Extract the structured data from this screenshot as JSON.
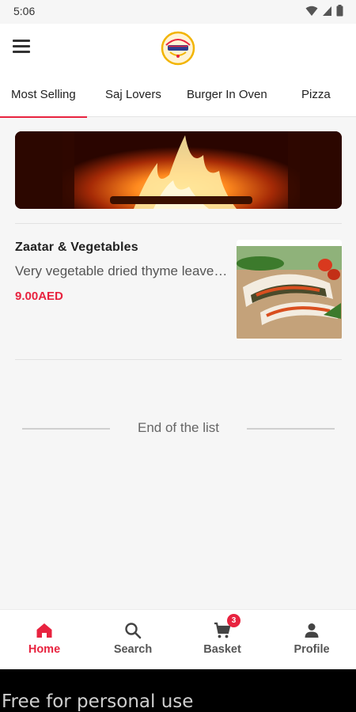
{
  "status_bar": {
    "time": "5:06",
    "icons": [
      "wifi-icon",
      "signal-icon",
      "battery-icon"
    ]
  },
  "app_bar": {
    "menu_icon": "hamburger-menu-icon",
    "logo": "restaurant-logo"
  },
  "tabs": [
    {
      "label": "Most Selling",
      "active": true
    },
    {
      "label": "Saj Lovers",
      "active": false
    },
    {
      "label": "Burger In Oven",
      "active": false
    },
    {
      "label": "Pizza",
      "active": false
    }
  ],
  "banner": {
    "image": "fire-oven-banner"
  },
  "products": [
    {
      "name": "Zaatar & Vegetables",
      "description": "Very vegetable dried thyme leaves with olive oil",
      "price": "9.00AED",
      "image": "wrap-sandwich-photo"
    }
  ],
  "end_of_list": "End of the list",
  "bottom_nav": {
    "items": [
      {
        "label": "Home",
        "icon": "home-icon",
        "active": true
      },
      {
        "label": "Search",
        "icon": "search-icon",
        "active": false
      },
      {
        "label": "Basket",
        "icon": "cart-icon",
        "active": false,
        "badge": "3"
      },
      {
        "label": "Profile",
        "icon": "person-icon",
        "active": false
      }
    ]
  },
  "watermark": "Free for personal use",
  "colors": {
    "accent": "#e8233f",
    "background": "#f6f6f6",
    "surface": "#ffffff"
  }
}
